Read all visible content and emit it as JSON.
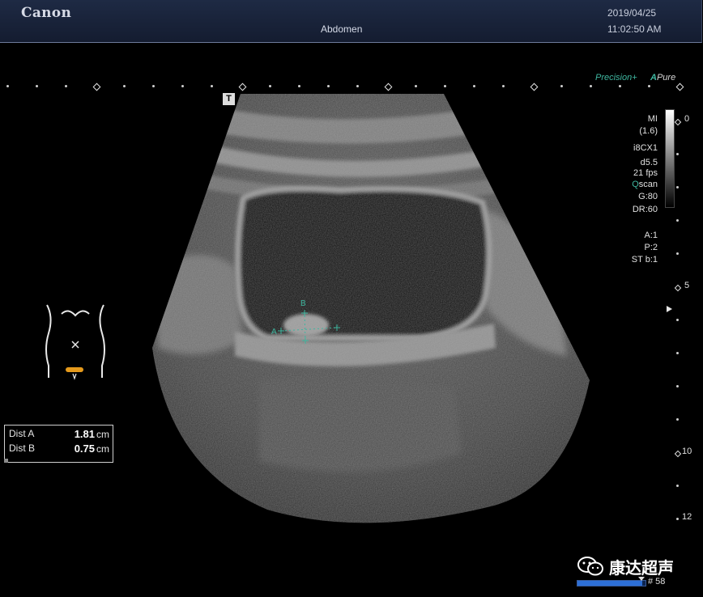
{
  "header": {
    "brand": "Canon",
    "exam": "Abdomen",
    "date": "2019/04/25",
    "time": "11:02:50 AM"
  },
  "modes": {
    "precision": "Precision+",
    "apure_a": "A",
    "apure": "Pure"
  },
  "t_marker": "T",
  "params": {
    "mi_label": "MI",
    "mi_value": "(1.6)",
    "probe": "i8CX1",
    "depth": "d5.5",
    "fps": "21 fps",
    "qscan_q": "Q",
    "qscan": "scan",
    "gain": "G:80",
    "dr": "DR:60",
    "a": "A:1",
    "p": "P:2",
    "st": "ST b:1"
  },
  "depth_scale": {
    "d0": "0",
    "d5": "5",
    "d10": "10",
    "d12": "12"
  },
  "calipers": {
    "a": "A",
    "b": "B"
  },
  "measurements": [
    {
      "label": "Dist A",
      "value": "1.81",
      "unit": "cm"
    },
    {
      "label": "Dist B",
      "value": "0.75",
      "unit": "cm"
    }
  ],
  "watermark": "康达超声",
  "frame": "# 58",
  "cine_progress": 0.95,
  "colors": {
    "accent": "#3fb7a0",
    "header_bg": "#1a2440",
    "bodymark_probe": "#e59a1c"
  }
}
